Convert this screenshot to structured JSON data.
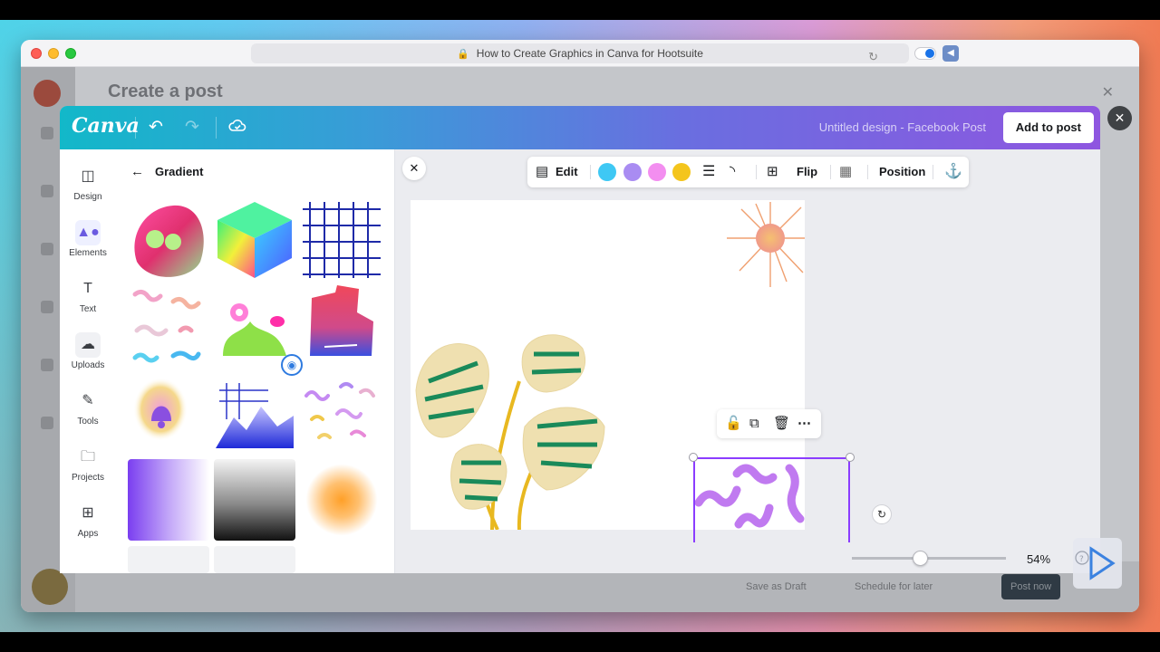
{
  "browser": {
    "address_text": "How to Create Graphics in Canva for Hootsuite",
    "lock_icon": "lock-icon",
    "reload_icon": "reload-icon"
  },
  "behind": {
    "title": "Create a post",
    "btn_draft": "Save as Draft",
    "btn_schedule": "Schedule for later",
    "btn_post": "Post now"
  },
  "canva": {
    "logo": "Canva",
    "design_title": "Untitled design - Facebook Post",
    "add_to_post": "Add to post",
    "rail": [
      {
        "label": "Design",
        "icon": "design-icon"
      },
      {
        "label": "Elements",
        "icon": "elements-icon"
      },
      {
        "label": "Text",
        "icon": "text-icon"
      },
      {
        "label": "Uploads",
        "icon": "uploads-icon"
      },
      {
        "label": "Tools",
        "icon": "tools-icon"
      },
      {
        "label": "Projects",
        "icon": "projects-icon"
      },
      {
        "label": "Apps",
        "icon": "apps-icon"
      }
    ],
    "panel_title": "Gradient",
    "toolbar": {
      "edit": "Edit",
      "flip": "Flip",
      "position": "Position",
      "swatches": [
        "#3ec8f4",
        "#a98cf2",
        "#f38ef0",
        "#f4c51c"
      ]
    },
    "zoom": "54%",
    "zoom_fraction": 0.44
  },
  "colors": {
    "canva_purple": "#8b3dff",
    "header_start": "#12b8c9",
    "header_end": "#8e56e0"
  }
}
